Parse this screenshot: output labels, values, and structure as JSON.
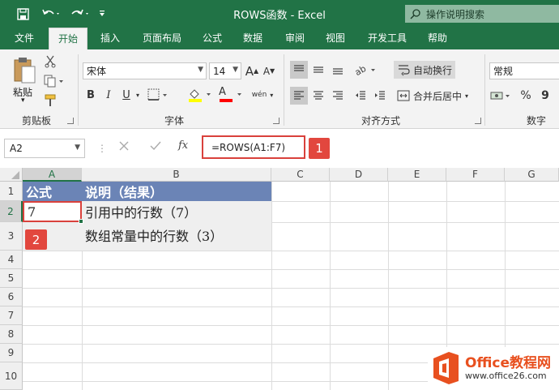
{
  "window": {
    "title": "ROWS函数  -  Excel",
    "tellme": "操作说明搜索"
  },
  "tabs": [
    "文件",
    "开始",
    "插入",
    "页面布局",
    "公式",
    "数据",
    "审阅",
    "视图",
    "开发工具",
    "帮助"
  ],
  "active_tab": "开始",
  "ribbon": {
    "clipboard": {
      "paste": "粘贴",
      "label": "剪贴板"
    },
    "font": {
      "name": "宋体",
      "size": "14",
      "label": "字体",
      "grow": "A",
      "shrink": "A",
      "bold": "B",
      "italic": "I",
      "underline": "U",
      "font_color": "A",
      "phonetic": "wén"
    },
    "alignment": {
      "wrap": "自动换行",
      "merge": "合并后居中",
      "label": "对齐方式"
    },
    "number": {
      "format": "常规",
      "percent": "%",
      "comma": "9",
      "label": "数字"
    },
    "colors": {
      "ribbon_green": "#217346",
      "highlight": "#ffff00",
      "font_red": "#ff0000"
    }
  },
  "formula_bar": {
    "name_box": "A2",
    "fx": "fx",
    "formula": "=ROWS(A1:F7)"
  },
  "badges": {
    "one": "1",
    "two": "2"
  },
  "columns": [
    "A",
    "B",
    "C",
    "D",
    "E",
    "F",
    "G"
  ],
  "rows": [
    "1",
    "2",
    "3",
    "4",
    "5",
    "6",
    "7",
    "8",
    "9",
    "10"
  ],
  "cells": {
    "A1": "公式",
    "B1": "说明（结果）",
    "A2": "7",
    "B2": "引用中的行数（7）",
    "B3": "数组常量中的行数（3）"
  },
  "watermark": {
    "brand": "Office教程网",
    "url": "www.office26.com"
  }
}
